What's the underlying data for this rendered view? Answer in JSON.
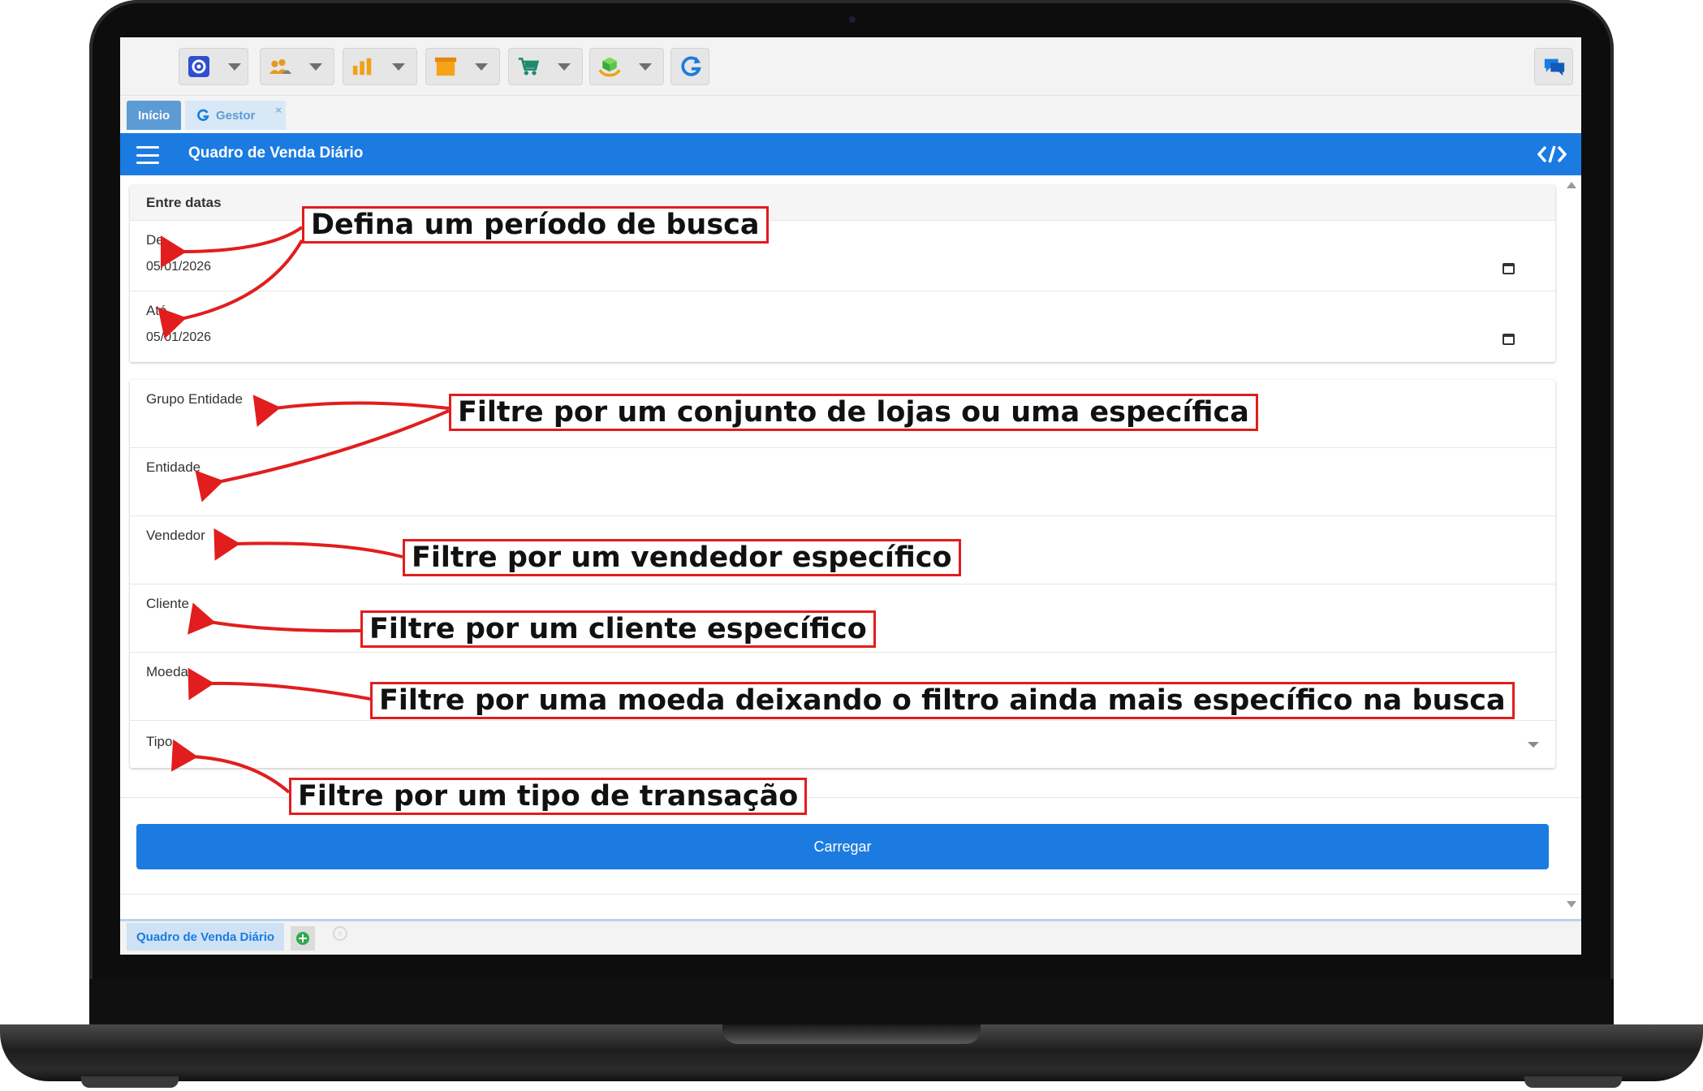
{
  "toolbar": {
    "icons": [
      "gear-icon",
      "users-icon",
      "bar-chart-icon",
      "box-icon",
      "cart-icon",
      "hand-box-icon",
      "refresh-g-icon",
      "chat-icon"
    ]
  },
  "tabs": {
    "inicio": "Início",
    "gestor": "Gestor",
    "close": "×"
  },
  "header": {
    "title": "Quadro de Venda Diário"
  },
  "dates": {
    "section_title": "Entre datas",
    "from_label": "De",
    "from_value": "05/01/2026",
    "to_label": "Até",
    "to_value": "05/01/2026"
  },
  "filters": {
    "grupo_entidade": "Grupo Entidade",
    "entidade": "Entidade",
    "vendedor": "Vendedor",
    "cliente": "Cliente",
    "moeda": "Moeda",
    "tipo": "Tipo"
  },
  "actions": {
    "load": "Carregar"
  },
  "bottom": {
    "tab_label": "Quadro de Venda Diário",
    "close": "×"
  },
  "annotations": {
    "periodo": "Defina um período de busca",
    "lojas": "Filtre por um conjunto de lojas ou uma específica",
    "vendedor": "Filtre por um vendedor específico",
    "cliente": "Filtre por um cliente específico",
    "moeda": "Filtre por uma moeda deixando o filtro ainda mais específico na busca",
    "tipo": "Filtre por um tipo de transação"
  },
  "colors": {
    "primary": "#1b7be0",
    "annotation": "#e21d1d"
  }
}
